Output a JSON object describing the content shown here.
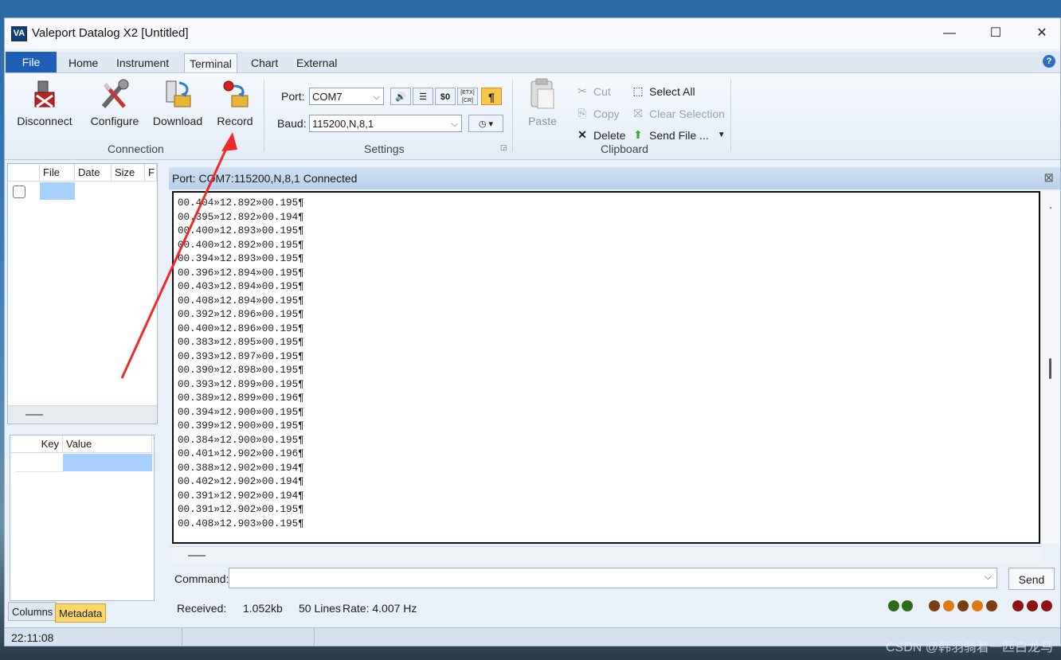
{
  "window": {
    "title": "Valeport Datalog X2 [Untitled]",
    "minimize": "—",
    "maximize": "☐",
    "close": "✕",
    "icon_text": "VA"
  },
  "ribbon_tabs": {
    "file": "File",
    "home": "Home",
    "instrument": "Instrument",
    "terminal": "Terminal",
    "chart": "Chart",
    "external": "External",
    "help": "?"
  },
  "connection": {
    "disconnect": "Disconnect",
    "configure": "Configure",
    "download": "Download",
    "record": "Record",
    "group_label": "Connection"
  },
  "settings": {
    "port_label": "Port:",
    "port_value": "COM7",
    "baud_label": "Baud:",
    "baud_value": "115200,N,8,1",
    "dollar_btn": "$0",
    "etx_btn": "[ETX] [CR]",
    "pilcrow_btn": "¶",
    "group_label": "Settings"
  },
  "clipboard": {
    "paste": "Paste",
    "cut": "Cut",
    "copy": "Copy",
    "delete": "Delete",
    "select_all": "Select All",
    "clear_selection": "Clear Selection",
    "send_file": "Send File ...",
    "group_label": "Clipboard"
  },
  "file_table": {
    "headers": [
      "File",
      "Date",
      "Size",
      "F"
    ]
  },
  "metadata_table": {
    "headers": [
      "Key",
      "Value"
    ]
  },
  "bottom_tabs": {
    "columns": "Columns",
    "metadata": "Metadata"
  },
  "terminal": {
    "header": "Port: COM7:115200,N,8,1 Connected",
    "close": "⊠",
    "lines": [
      "00.404»12.892»00.195¶",
      "00.395»12.892»00.194¶",
      "00.400»12.893»00.195¶",
      "00.400»12.892»00.195¶",
      "00.394»12.893»00.195¶",
      "00.396»12.894»00.195¶",
      "00.403»12.894»00.195¶",
      "00.408»12.894»00.195¶",
      "00.392»12.896»00.195¶",
      "00.400»12.896»00.195¶",
      "00.383»12.895»00.195¶",
      "00.393»12.897»00.195¶",
      "00.390»12.898»00.195¶",
      "00.393»12.899»00.195¶",
      "00.389»12.899»00.196¶",
      "00.394»12.900»00.195¶",
      "00.399»12.900»00.195¶",
      "00.384»12.900»00.195¶",
      "00.401»12.902»00.196¶",
      "00.388»12.902»00.194¶",
      "00.402»12.902»00.194¶",
      "00.391»12.902»00.194¶",
      "00.391»12.902»00.195¶",
      "00.408»12.903»00.195¶"
    ]
  },
  "command": {
    "label": "Command:",
    "value": "",
    "send": "Send"
  },
  "status": {
    "received_label": "Received:",
    "received_value": "1.052kb",
    "lines": "50 Lines",
    "rate": "Rate: 4.007 Hz"
  },
  "indicator_colors": {
    "green": "#2e6b1a",
    "orange": "#e07a10",
    "brown": "#7a3e10",
    "red": "#8b1515"
  },
  "clock": "22:11:08",
  "watermark": "CSDN @韩羽骑着一匹白龙马"
}
